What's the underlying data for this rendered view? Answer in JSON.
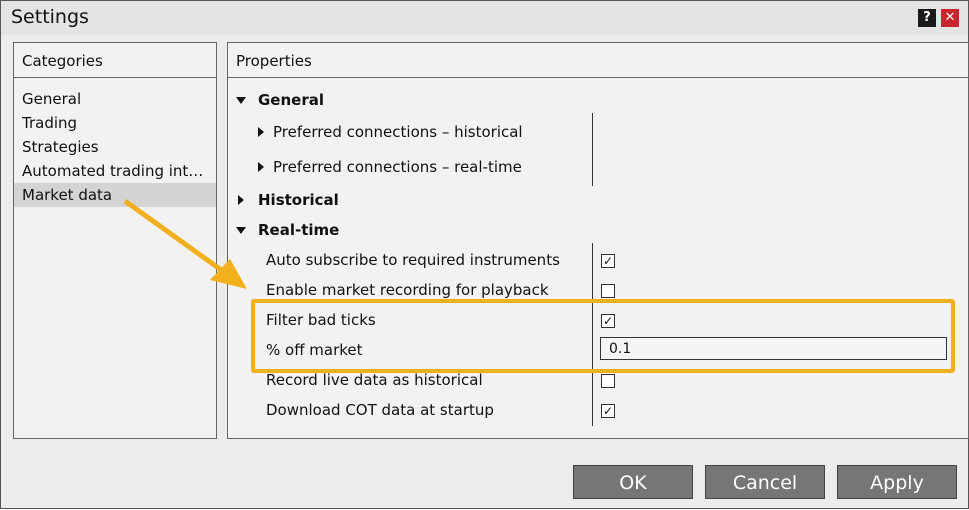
{
  "window": {
    "title": "Settings",
    "help_label": "?",
    "close_label": "✕"
  },
  "categories": {
    "header": "Categories",
    "items": [
      {
        "label": "General"
      },
      {
        "label": "Trading"
      },
      {
        "label": "Strategies"
      },
      {
        "label": "Automated trading int…"
      },
      {
        "label": "Market data",
        "selected": true
      }
    ]
  },
  "properties": {
    "header": "Properties",
    "general": {
      "label": "General",
      "items": [
        {
          "label": "Preferred connections – historical"
        },
        {
          "label": "Preferred connections – real-time"
        }
      ]
    },
    "historical": {
      "label": "Historical"
    },
    "realtime": {
      "label": "Real-time",
      "items": [
        {
          "label": "Auto subscribe to required instruments",
          "checked": true
        },
        {
          "label": "Enable market recording for playback",
          "checked": false
        },
        {
          "label": "Filter bad ticks",
          "checked": true
        },
        {
          "label": "% off market",
          "value": "0.1"
        },
        {
          "label": "Record live data as historical",
          "checked": false
        },
        {
          "label": "Download COT data at startup",
          "checked": true
        }
      ]
    }
  },
  "buttons": {
    "ok": "OK",
    "cancel": "Cancel",
    "apply": "Apply"
  },
  "colors": {
    "highlight": "#f2b01e",
    "close": "#c8252c",
    "button": "#767676"
  }
}
